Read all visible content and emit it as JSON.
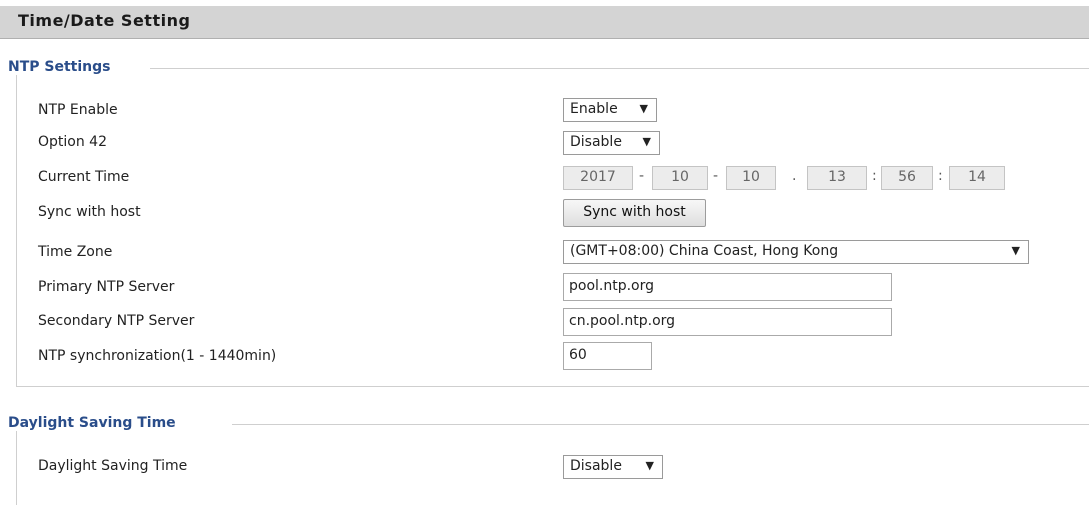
{
  "page_title": "Time/Date Setting",
  "ntp_section": {
    "legend": "NTP Settings",
    "ntp_enable": {
      "label": "NTP Enable",
      "value": "Enable"
    },
    "option42": {
      "label": "Option 42",
      "value": "Disable"
    },
    "current_time": {
      "label": "Current Time",
      "year": "2017",
      "month": "10",
      "day": "10",
      "hour": "13",
      "minute": "56",
      "second": "14",
      "sep_dash": "-",
      "sep_dot": ".",
      "sep_colon": ":"
    },
    "sync_host": {
      "label": "Sync with host",
      "button": "Sync with host"
    },
    "time_zone": {
      "label": "Time Zone",
      "value": "(GMT+08:00) China Coast, Hong Kong"
    },
    "primary_ntp": {
      "label": "Primary NTP Server",
      "value": "pool.ntp.org"
    },
    "secondary_ntp": {
      "label": "Secondary NTP Server",
      "value": "cn.pool.ntp.org"
    },
    "ntp_sync": {
      "label": "NTP synchronization(1 - 1440min)",
      "value": "60"
    }
  },
  "dst_section": {
    "legend": "Daylight Saving Time",
    "dst": {
      "label": "Daylight Saving Time",
      "value": "Disable"
    }
  },
  "icons": {
    "dropdown_arrow": "▼"
  }
}
